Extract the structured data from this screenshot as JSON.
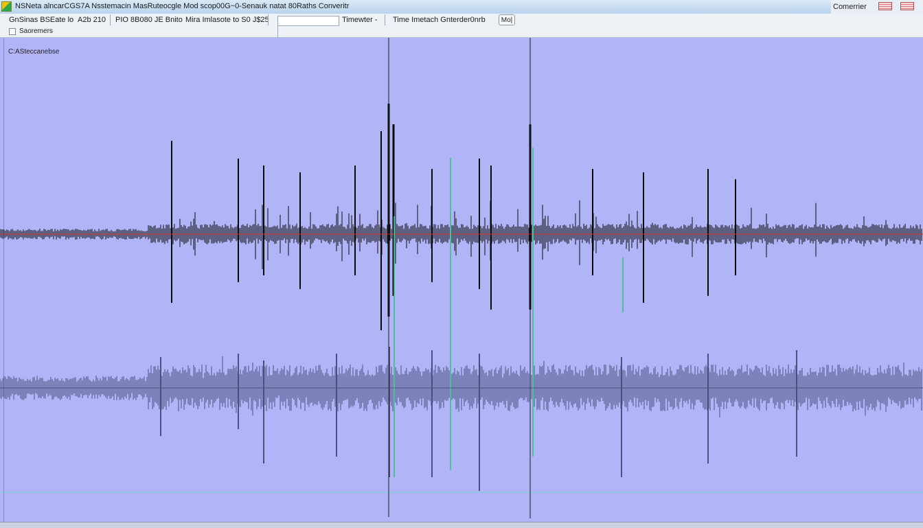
{
  "window": {
    "title": "NSNeta alncarCGS7A Nsstemacin MasRuteocgle Mod scop00G~0-Senauk natat 80Raths Converitr",
    "right_label": "Comerrier"
  },
  "toolbar": {
    "item1": "GnSinas BSEate lo",
    "item2": "A2b 210",
    "item3": "PIO 8B080 JE Bnito",
    "item4": "Mira Imlasote to S0 J$25",
    "time_dropdown": "Timewter -",
    "time_match": "Time Imetach Gnterder0nrb",
    "btn_label": "Mo|",
    "checkbox_label": "Saoremers"
  },
  "plot": {
    "path_label": "C:ASteccanebse",
    "background": "#b1b5f8",
    "trace_colors": {
      "top": "#0a0a0a",
      "bottom": "#4a4f7e",
      "baseline": "#e03030",
      "markers": "#1a1a1a",
      "highlight": "#2ec27e"
    }
  }
}
